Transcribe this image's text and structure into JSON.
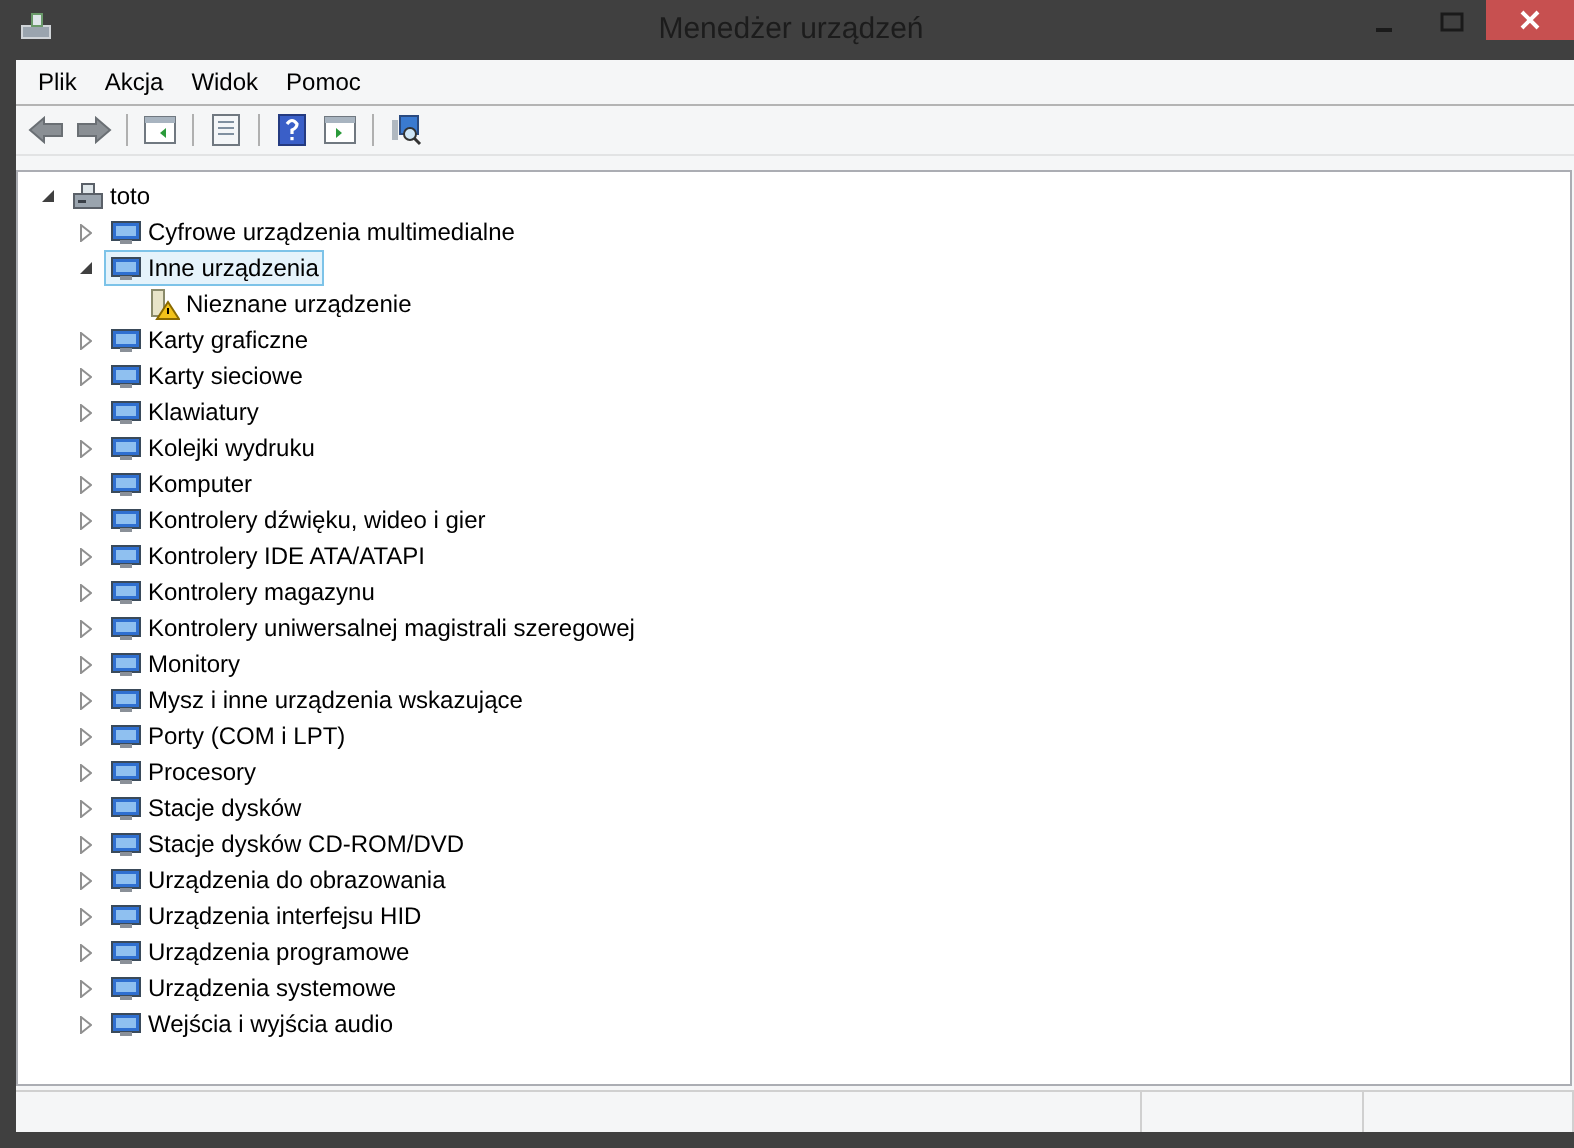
{
  "window": {
    "title": "Menedżer urządzeń"
  },
  "menu": [
    "Plik",
    "Akcja",
    "Widok",
    "Pomoc"
  ],
  "tree": {
    "label": "toto",
    "expanded": true,
    "selected": false,
    "warning": false,
    "children": [
      {
        "label": "Cyfrowe urządzenia multimedialne",
        "expanded": false,
        "selected": false,
        "warning": false
      },
      {
        "label": "Inne urządzenia",
        "expanded": true,
        "selected": true,
        "warning": false,
        "children": [
          {
            "label": "Nieznane urządzenie",
            "selected": false,
            "warning": true
          }
        ]
      },
      {
        "label": "Karty graficzne",
        "expanded": false,
        "selected": false,
        "warning": false
      },
      {
        "label": "Karty sieciowe",
        "expanded": false,
        "selected": false,
        "warning": false
      },
      {
        "label": "Klawiatury",
        "expanded": false,
        "selected": false,
        "warning": false
      },
      {
        "label": "Kolejki wydruku",
        "expanded": false,
        "selected": false,
        "warning": false
      },
      {
        "label": "Komputer",
        "expanded": false,
        "selected": false,
        "warning": false
      },
      {
        "label": "Kontrolery dźwięku, wideo i gier",
        "expanded": false,
        "selected": false,
        "warning": false
      },
      {
        "label": "Kontrolery IDE ATA/ATAPI",
        "expanded": false,
        "selected": false,
        "warning": false
      },
      {
        "label": "Kontrolery magazynu",
        "expanded": false,
        "selected": false,
        "warning": false
      },
      {
        "label": "Kontrolery uniwersalnej magistrali szeregowej",
        "expanded": false,
        "selected": false,
        "warning": false
      },
      {
        "label": "Monitory",
        "expanded": false,
        "selected": false,
        "warning": false
      },
      {
        "label": "Mysz i inne urządzenia wskazujące",
        "expanded": false,
        "selected": false,
        "warning": false
      },
      {
        "label": "Porty (COM i LPT)",
        "expanded": false,
        "selected": false,
        "warning": false
      },
      {
        "label": "Procesory",
        "expanded": false,
        "selected": false,
        "warning": false
      },
      {
        "label": "Stacje dysków",
        "expanded": false,
        "selected": false,
        "warning": false
      },
      {
        "label": "Stacje dysków CD-ROM/DVD",
        "expanded": false,
        "selected": false,
        "warning": false
      },
      {
        "label": "Urządzenia do obrazowania",
        "expanded": false,
        "selected": false,
        "warning": false
      },
      {
        "label": "Urządzenia interfejsu HID",
        "expanded": false,
        "selected": false,
        "warning": false
      },
      {
        "label": "Urządzenia programowe",
        "expanded": false,
        "selected": false,
        "warning": false
      },
      {
        "label": "Urządzenia systemowe",
        "expanded": false,
        "selected": false,
        "warning": false
      },
      {
        "label": "Wejścia i wyjścia audio",
        "expanded": false,
        "selected": false,
        "warning": false
      }
    ]
  }
}
